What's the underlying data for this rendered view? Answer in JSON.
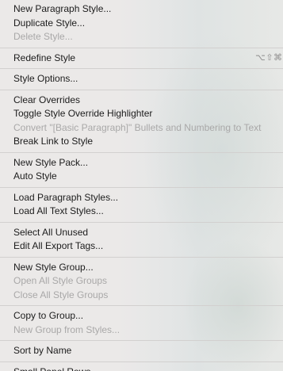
{
  "menu": {
    "groups": [
      {
        "items": [
          {
            "label": "New Paragraph Style...",
            "enabled": true
          },
          {
            "label": "Duplicate Style...",
            "enabled": true
          },
          {
            "label": "Delete Style...",
            "enabled": false
          }
        ]
      },
      {
        "items": [
          {
            "label": "Redefine Style",
            "enabled": true,
            "shortcut": "⌥⇧⌘R"
          }
        ]
      },
      {
        "items": [
          {
            "label": "Style Options...",
            "enabled": true
          }
        ]
      },
      {
        "items": [
          {
            "label": "Clear Overrides",
            "enabled": true
          },
          {
            "label": "Toggle Style Override Highlighter",
            "enabled": true
          },
          {
            "label": "Convert \"[Basic Paragraph]\" Bullets and Numbering to Text",
            "enabled": false
          },
          {
            "label": "Break Link to Style",
            "enabled": true
          }
        ]
      },
      {
        "items": [
          {
            "label": "New Style Pack...",
            "enabled": true
          },
          {
            "label": "Auto Style",
            "enabled": true
          }
        ]
      },
      {
        "items": [
          {
            "label": "Load Paragraph Styles...",
            "enabled": true
          },
          {
            "label": "Load All Text Styles...",
            "enabled": true
          }
        ]
      },
      {
        "items": [
          {
            "label": "Select All Unused",
            "enabled": true
          },
          {
            "label": "Edit All Export Tags...",
            "enabled": true
          }
        ]
      },
      {
        "items": [
          {
            "label": "New Style Group...",
            "enabled": true
          },
          {
            "label": "Open All Style Groups",
            "enabled": false
          },
          {
            "label": "Close All Style Groups",
            "enabled": false
          }
        ]
      },
      {
        "items": [
          {
            "label": "Copy to Group...",
            "enabled": true
          },
          {
            "label": "New Group from Styles...",
            "enabled": false
          }
        ]
      },
      {
        "items": [
          {
            "label": "Sort by Name",
            "enabled": true
          }
        ]
      },
      {
        "items": [
          {
            "label": "Small Panel Rows",
            "enabled": true
          }
        ]
      }
    ]
  }
}
